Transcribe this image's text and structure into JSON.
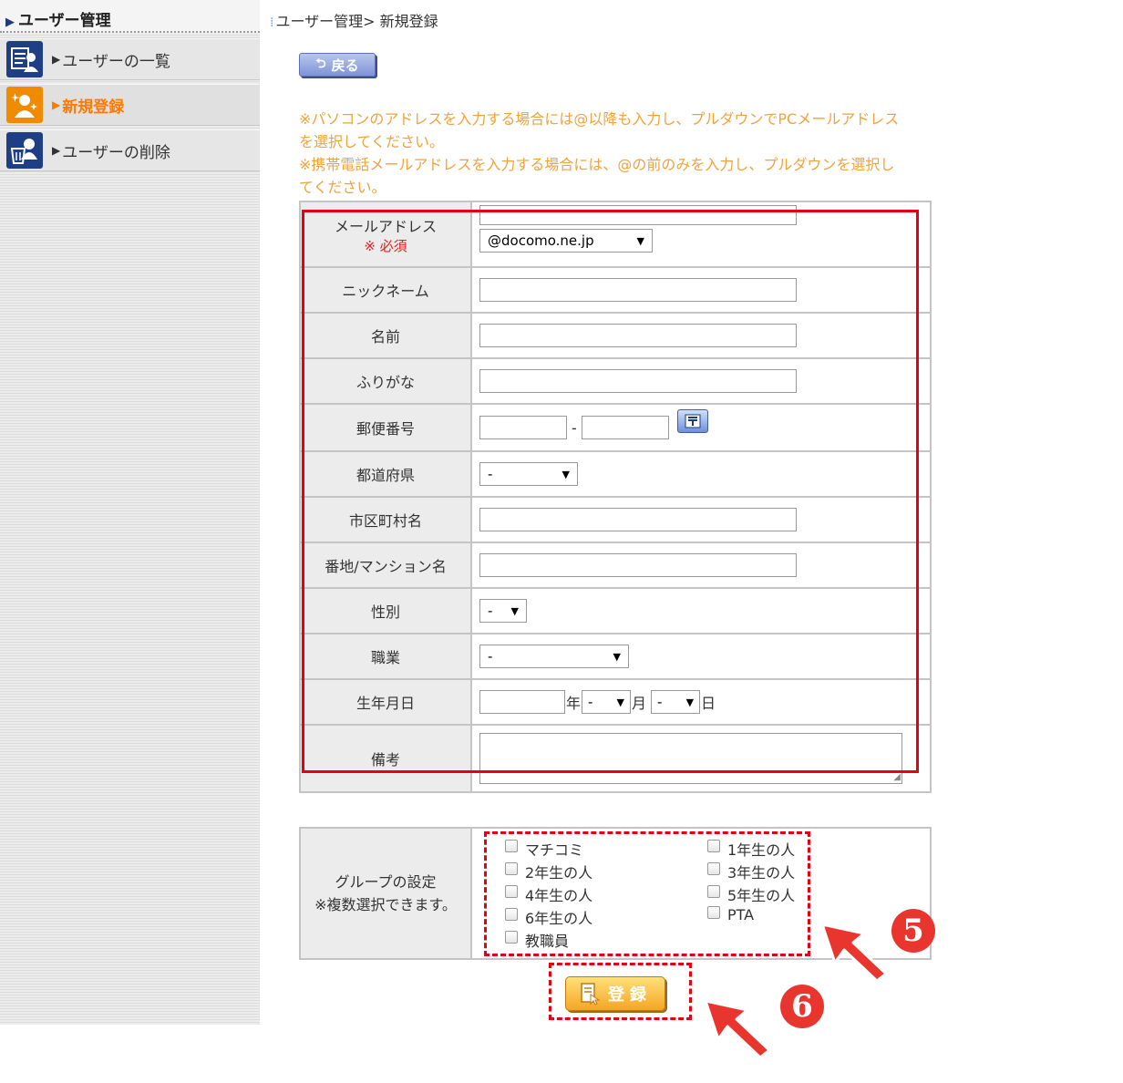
{
  "sidebar": {
    "header": "ユーザー管理",
    "items": [
      {
        "label": "ユーザーの一覧"
      },
      {
        "label": "新規登録"
      },
      {
        "label": "ユーザーの削除"
      }
    ]
  },
  "breadcrumb": "ユーザー管理> 新規登録",
  "back_button": "戻る",
  "notes": [
    "※パソコンのアドレスを入力する場合には@以降も入力し、プルダウンでPCメールアドレス",
    "を選択してください。",
    "※携帯電話メールアドレスを入力する場合には、@の前のみを入力し、プルダウンを選択し",
    "てください。"
  ],
  "form": {
    "email_label": "メールアドレス",
    "required_mark": "※ 必須",
    "email_domain": "@docomo.ne.jp",
    "nickname_label": "ニックネーム",
    "name_label": "名前",
    "furigana_label": "ふりがな",
    "zip_label": "郵便番号",
    "zip_separator": "-",
    "prefecture_label": "都道府県",
    "prefecture_value": "-",
    "city_label": "市区町村名",
    "address_label": "番地/マンション名",
    "gender_label": "性別",
    "gender_value": "-",
    "job_label": "職業",
    "job_value": "-",
    "birthday_label": "生年月日",
    "year_unit": "年",
    "month_value": "-",
    "month_unit": "月",
    "day_value": "-",
    "day_unit": "日",
    "notes_label": "備考"
  },
  "group": {
    "label_line1": "グループの設定",
    "label_line2": "※複数選択できます。",
    "options": [
      "マチコミ",
      "1年生の人",
      "2年生の人",
      "3年生の人",
      "4年生の人",
      "5年生の人",
      "6年生の人",
      "PTA",
      "教職員"
    ]
  },
  "submit_button": "登録",
  "callouts": {
    "step5": "5",
    "step6": "6"
  },
  "colors": {
    "note": "#f2a23c",
    "highlight": "#e60012",
    "active": "#ff7a00",
    "nav": "#1e3f86"
  }
}
